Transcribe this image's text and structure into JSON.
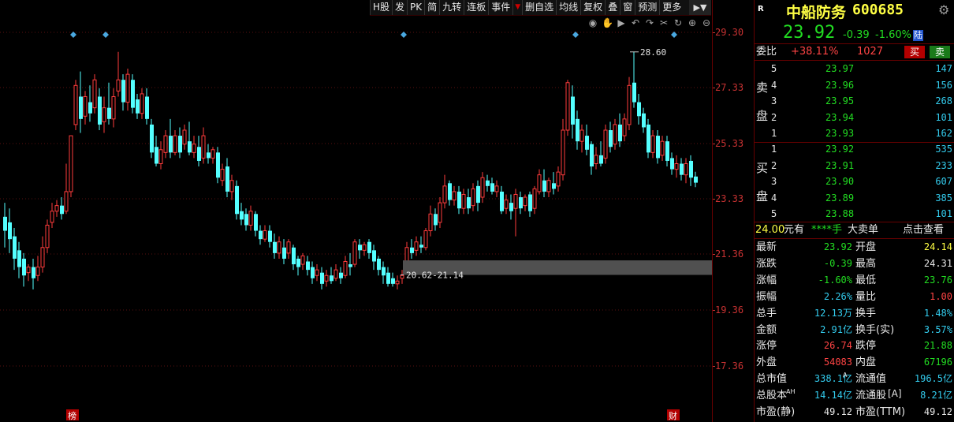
{
  "toolbar": {
    "items": [
      "H股",
      "发",
      "PK",
      "简",
      "九转",
      "连板",
      "事件",
      "删自选",
      "均线",
      "复权",
      "叠",
      "窗",
      "预测",
      "更多"
    ]
  },
  "chart": {
    "y_ticks": [
      "29.30",
      "27.33",
      "25.33",
      "23.33",
      "21.36",
      "19.36",
      "17.36"
    ],
    "high_label": "28.60",
    "range_label": "20.62-21.14",
    "marker_left": "榜",
    "marker_right": "财"
  },
  "chart_data": {
    "type": "candlestick",
    "ylim": [
      17.36,
      29.3
    ],
    "high": 28.6,
    "low_zone": [
      20.62,
      21.14
    ]
  },
  "stock": {
    "badge": "R",
    "name": "中船防务",
    "code": "600685",
    "price": "23.92",
    "change": "-0.39",
    "change_pct": "-1.60%",
    "market": "陆"
  },
  "order": {
    "weibi_label": "委比",
    "weibi_pct": "+38.11%",
    "weicha": "1027",
    "buy_btn": "买",
    "sell_btn": "卖"
  },
  "asks_label_top": "卖",
  "asks_label_bottom": "盘",
  "asks": [
    {
      "level": "5",
      "price": "23.97",
      "vol": "147"
    },
    {
      "level": "4",
      "price": "23.96",
      "vol": "156"
    },
    {
      "level": "3",
      "price": "23.95",
      "vol": "268"
    },
    {
      "level": "2",
      "price": "23.94",
      "vol": "101"
    },
    {
      "level": "1",
      "price": "23.93",
      "vol": "162"
    }
  ],
  "bids_label_top": "买",
  "bids_label_bottom": "盘",
  "bids": [
    {
      "level": "1",
      "price": "23.92",
      "vol": "535"
    },
    {
      "level": "2",
      "price": "23.91",
      "vol": "233"
    },
    {
      "level": "3",
      "price": "23.90",
      "vol": "607"
    },
    {
      "level": "4",
      "price": "23.89",
      "vol": "385"
    },
    {
      "level": "5",
      "price": "23.88",
      "vol": "101"
    }
  ],
  "big_order": {
    "price": "24.00",
    "text1": "元有",
    "stars": "****手",
    "text2": "大卖单",
    "link": "点击查看"
  },
  "stats": [
    {
      "l1": "最新",
      "v1": "23.92",
      "c1": "g",
      "l2": "开盘",
      "v2": "24.14",
      "c2": "y"
    },
    {
      "l1": "涨跌",
      "v1": "-0.39",
      "c1": "g",
      "l2": "最高",
      "v2": "24.31",
      "c2": "w"
    },
    {
      "l1": "涨幅",
      "v1": "-1.60%",
      "c1": "g",
      "l2": "最低",
      "v2": "23.76",
      "c2": "g"
    },
    {
      "l1": "振幅",
      "v1": "2.26%",
      "c1": "c",
      "l2": "量比",
      "v2": "1.00",
      "c2": "r"
    },
    {
      "l1": "总手",
      "v1": "12.13万",
      "c1": "c",
      "l2": "换手",
      "v2": "1.48%",
      "c2": "c"
    },
    {
      "l1": "金额",
      "v1": "2.91亿",
      "c1": "c",
      "l2": "换手(实)",
      "v2": "3.57%",
      "c2": "c"
    },
    {
      "l1": "涨停",
      "v1": "26.74",
      "c1": "r",
      "l2": "跌停",
      "v2": "21.88",
      "c2": "g"
    },
    {
      "l1": "外盘",
      "v1": "54083",
      "c1": "r",
      "l2": "内盘",
      "v2": "67196",
      "c2": "g"
    },
    {
      "l1": "总市值",
      "v1": "338.1亿",
      "c1": "c",
      "l2": "流通值",
      "v2": "196.5亿",
      "c2": "c"
    },
    {
      "l1": "总股本",
      "v1": "14.14亿",
      "c1": "c",
      "l2": "流通股",
      "v2": "8.21亿",
      "c2": "c"
    },
    {
      "l1": "市盈(静)",
      "v1": "49.12",
      "c1": "w",
      "l2": "市盈(TTM)",
      "v2": "49.12",
      "c2": "w"
    }
  ],
  "stat_marks": {
    "a_flow": "A",
    "ah": "AH",
    "a_bracket": "[A]"
  }
}
